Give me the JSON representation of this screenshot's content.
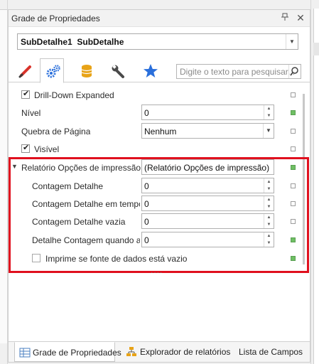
{
  "panel": {
    "title": "Grade de Propriedades",
    "pin_glyph": "ᚖ",
    "close_glyph": "✕"
  },
  "selector": {
    "value": "SubDetalhe1  SubDetalhe"
  },
  "tabs": [
    {
      "icon": "brush-icon",
      "active": false
    },
    {
      "icon": "gears-icon",
      "active": true
    },
    {
      "icon": "database-icon",
      "active": false
    },
    {
      "icon": "wrench-icon",
      "active": false
    },
    {
      "icon": "star-icon",
      "active": false
    }
  ],
  "search": {
    "placeholder": "Digite o texto para pesquisar..."
  },
  "properties": {
    "drilldown_expanded": {
      "label": "Drill-Down Expanded",
      "checked": true
    },
    "nivel": {
      "label": "Nível",
      "value": "0"
    },
    "quebra_pagina": {
      "label": "Quebra de Página",
      "value": "Nenhum"
    },
    "visivel": {
      "label": "Visível",
      "checked": true
    },
    "relatorio_opcoes": {
      "label": "Relatório Opções de impressão",
      "value": "(Relatório Opções de impressão)",
      "expanded": true
    },
    "contagem_detalhe": {
      "label": "Contagem Detalhe",
      "value": "0"
    },
    "contagem_detalhe_tempo": {
      "label": "Contagem Detalhe em tempo...",
      "value": "0"
    },
    "contagem_detalhe_vazia": {
      "label": "Contagem Detalhe vazia",
      "value": "0"
    },
    "detalhe_contagem_quando": {
      "label": "Detalhe Contagem quando a ...",
      "value": "0"
    },
    "imprime_vazio": {
      "label": "Imprime se fonte de dados está vazio",
      "checked": false
    }
  },
  "bottom_tabs": [
    {
      "label": "Grade de Propriedades",
      "icon": "property-grid-icon",
      "active": true
    },
    {
      "label": "Explorador de relatórios",
      "icon": "report-explorer-icon",
      "active": false
    },
    {
      "label": "Lista de Campos",
      "icon": "",
      "active": false
    }
  ],
  "colors": {
    "highlight": "#e0101e",
    "marker_set": "#6fbf64",
    "accent_blue": "#2a6fdb"
  }
}
